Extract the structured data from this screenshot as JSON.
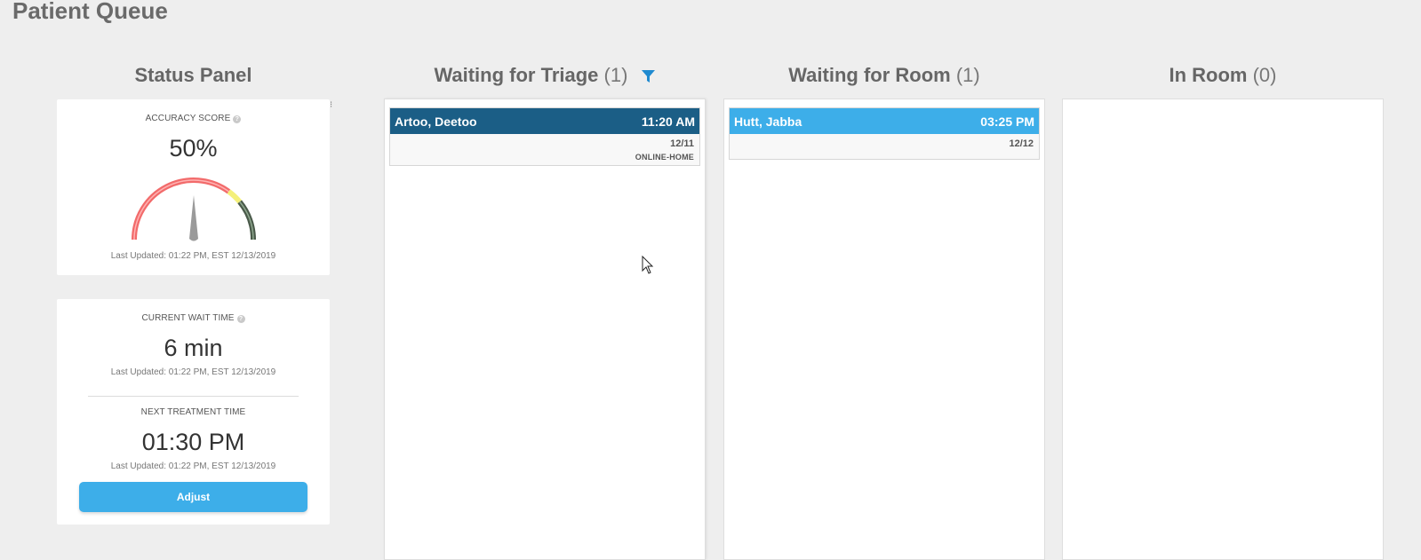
{
  "page": {
    "title": "Patient Queue"
  },
  "columns": {
    "status": {
      "title": "Status Panel"
    },
    "triage": {
      "title": "Waiting for Triage",
      "count": "(1)"
    },
    "room": {
      "title": "Waiting for Room",
      "count": "(1)"
    },
    "inroom": {
      "title": "In Room",
      "count": "(0)"
    }
  },
  "accuracy": {
    "label": "ACCURACY SCORE",
    "value": "50%",
    "score": 0.5,
    "updated": "Last Updated: 01:22 PM, EST 12/13/2019"
  },
  "wait": {
    "label": "CURRENT WAIT TIME",
    "value": "6 min",
    "updated": "Last Updated: 01:22 PM, EST 12/13/2019"
  },
  "treatment": {
    "label": "NEXT TREATMENT TIME",
    "value": "01:30 PM",
    "updated": "Last Updated: 01:22 PM, EST 12/13/2019",
    "button": "Adjust"
  },
  "triage_patients": [
    {
      "name": "Artoo, Deetoo",
      "time": "11:20 AM",
      "date": "12/11",
      "source": "ONLINE-HOME"
    }
  ],
  "room_patients": [
    {
      "name": "Hutt, Jabba",
      "time": "03:25 PM",
      "date": "12/12"
    }
  ],
  "icons": {
    "filter": "filter-icon",
    "help": "help-icon",
    "cursor": "mouse-pointer-icon"
  },
  "colors": {
    "accent": "#3daee9",
    "dark_header": "#1b5e86",
    "gauge_red": "#f26b6b",
    "gauge_yellow": "#f4f07a",
    "gauge_green": "#4a5a4a"
  }
}
